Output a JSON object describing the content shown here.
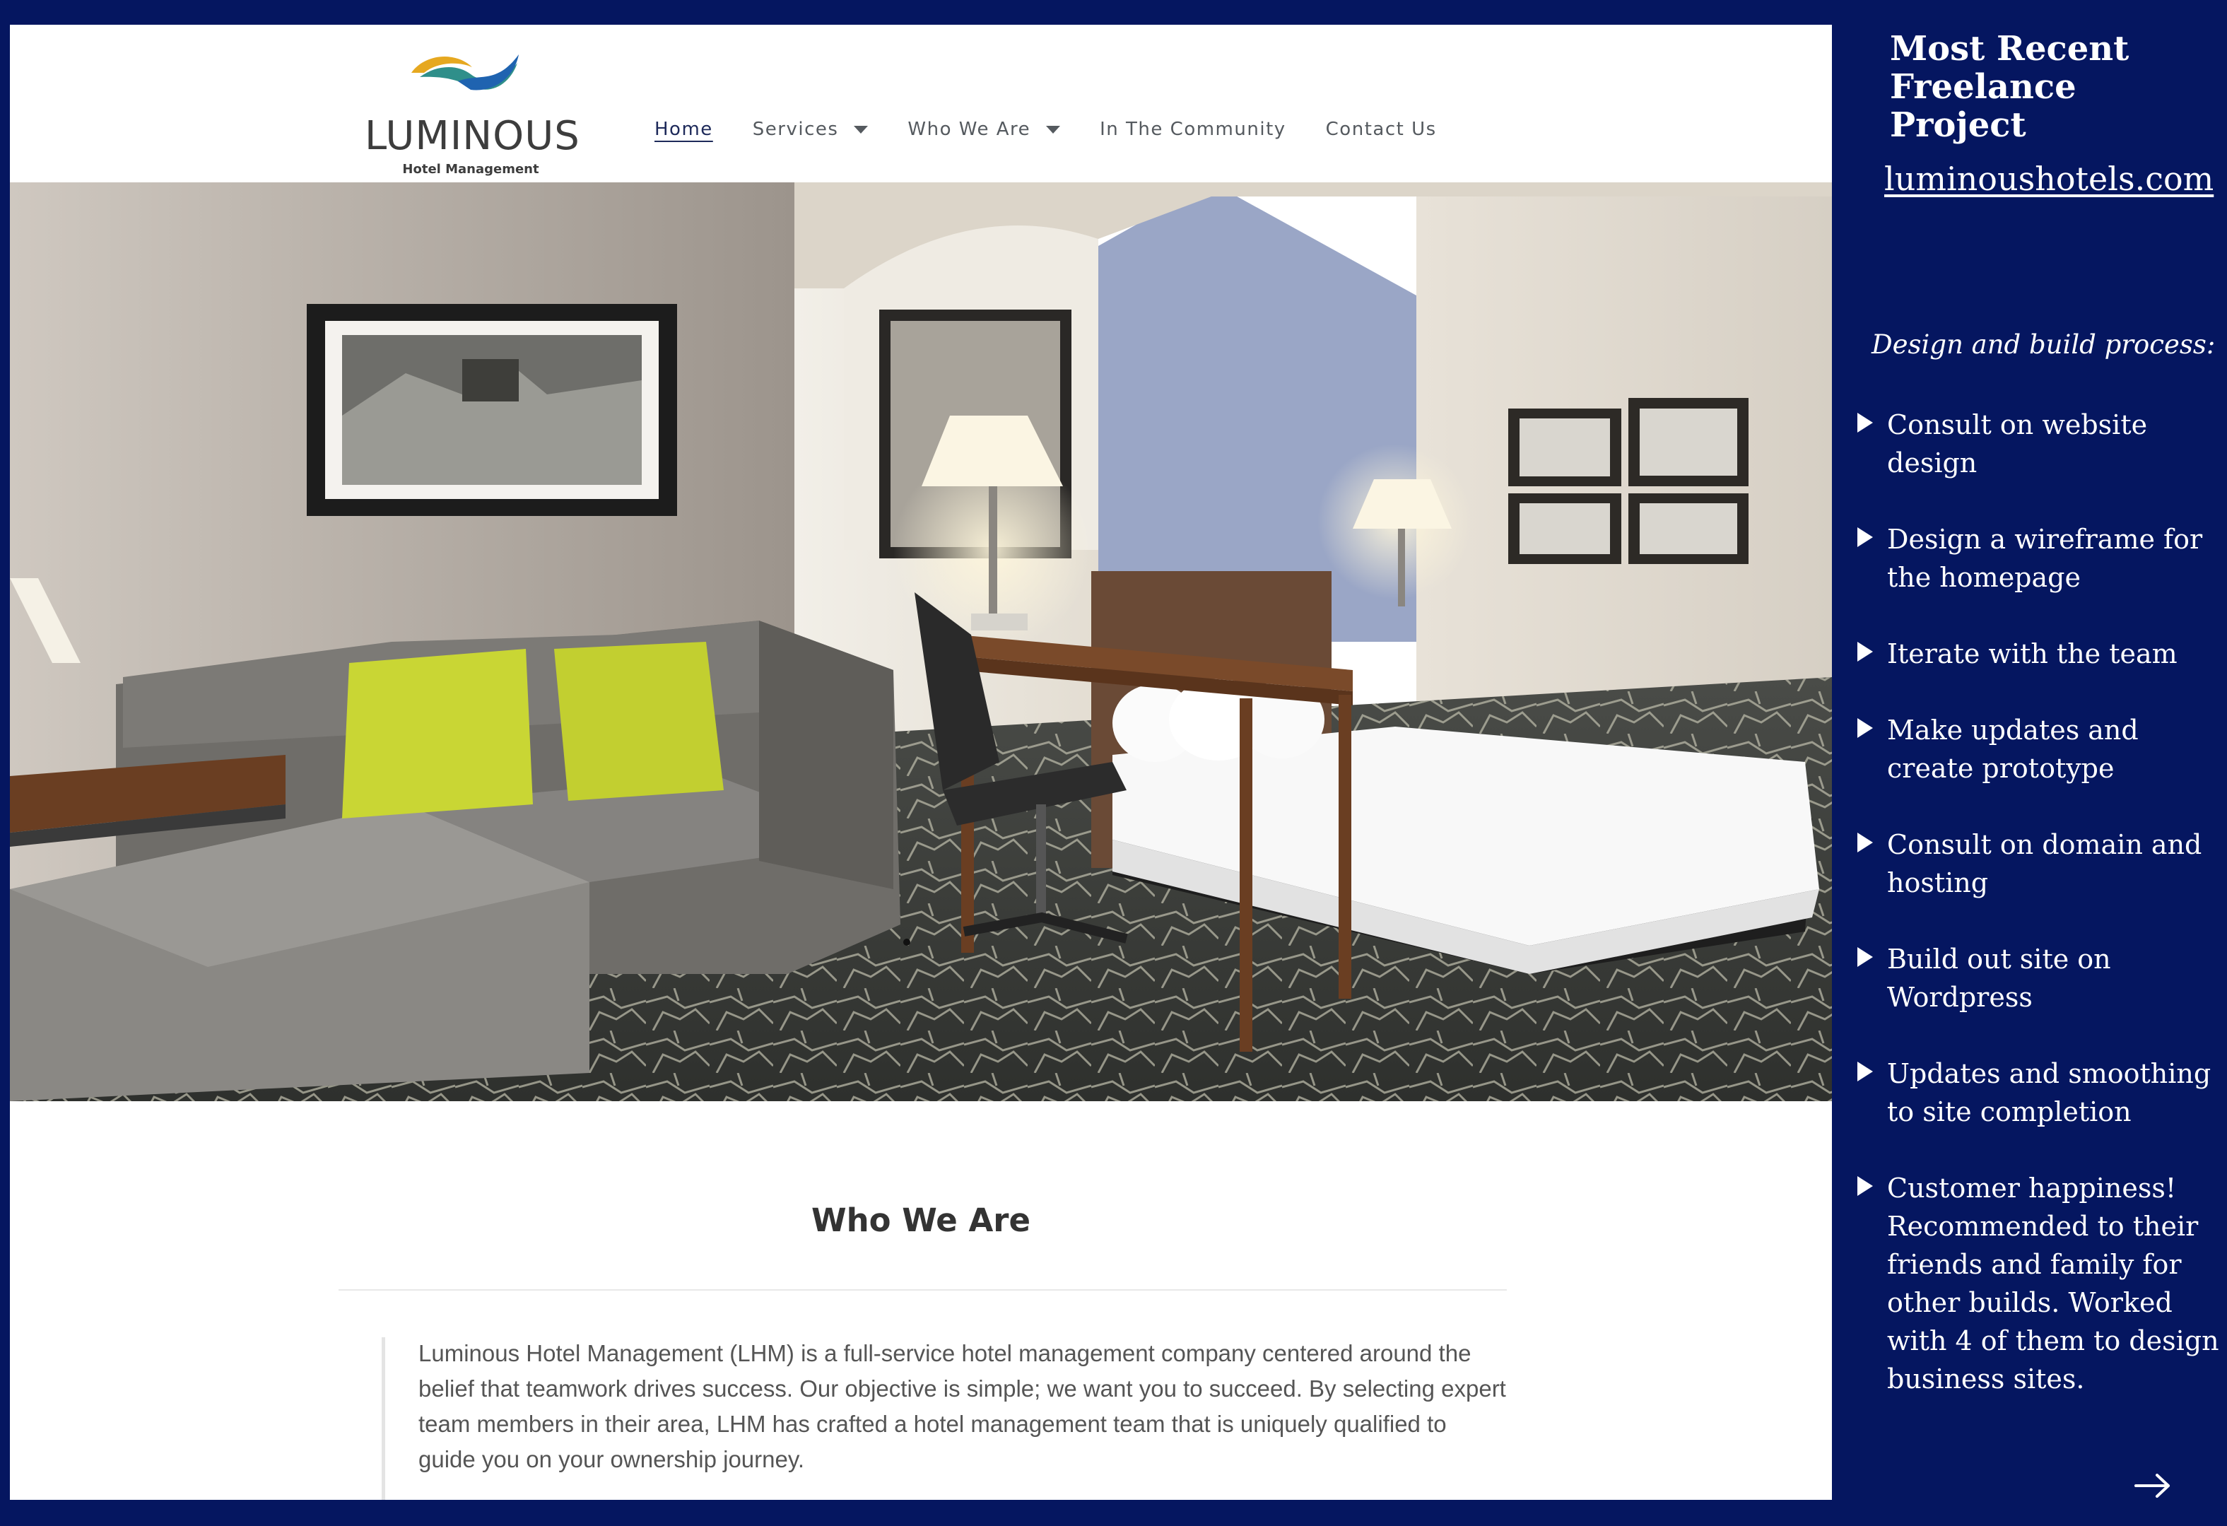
{
  "site": {
    "logo": {
      "wordmark": "LUMINOUS",
      "subtitle": "Hotel Management"
    },
    "nav": {
      "items": [
        {
          "label": "Home",
          "active": true,
          "has_dropdown": false
        },
        {
          "label": "Services",
          "active": false,
          "has_dropdown": true
        },
        {
          "label": "Who We Are",
          "active": false,
          "has_dropdown": true
        },
        {
          "label": "In The Community",
          "active": false,
          "has_dropdown": false
        },
        {
          "label": "Contact Us",
          "active": false,
          "has_dropdown": false
        }
      ]
    },
    "hero": {
      "image": "hotel-room-photo"
    },
    "who_we_are": {
      "heading": "Who We Are",
      "body": "Luminous Hotel Management (LHM) is a full-service hotel management company centered around the belief that teamwork drives success. Our objective is simple; we want you to succeed. By selecting expert team members in their area, LHM has crafted a hotel management team that is uniquely qualified to guide you on your ownership journey."
    }
  },
  "panel": {
    "title": "Most Recent Freelance Project",
    "link": "luminoushotels.com",
    "subtitle": "Design and build process:",
    "steps": [
      "Consult on website design",
      "Design a wireframe for the homepage",
      "Iterate with the team",
      "Make updates and create prototype",
      "Consult on domain and hosting",
      "Build out site on Wordpress",
      "Updates and smoothing to site completion",
      "Customer happiness! Recommended to their friends and family for other builds. Worked with 4 of them to design business sites."
    ],
    "next_icon": "arrow-right-icon"
  },
  "colors": {
    "frame": "#051660",
    "brand_blue": "#1f63b0",
    "brand_gold": "#e6a820",
    "brand_teal": "#2f8f8a",
    "pillow_green": "#c9d634"
  }
}
